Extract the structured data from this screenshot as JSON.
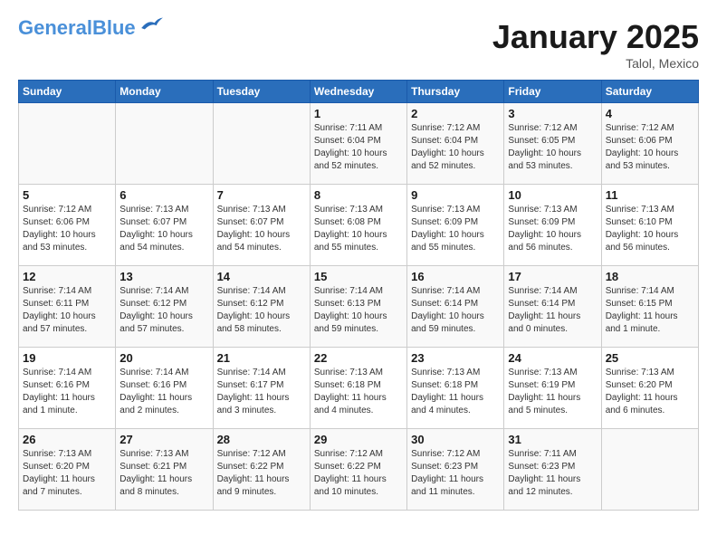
{
  "header": {
    "logo_general": "General",
    "logo_blue": "Blue",
    "title": "January 2025",
    "subtitle": "Talol, Mexico"
  },
  "days_of_week": [
    "Sunday",
    "Monday",
    "Tuesday",
    "Wednesday",
    "Thursday",
    "Friday",
    "Saturday"
  ],
  "weeks": [
    [
      {
        "num": "",
        "info": ""
      },
      {
        "num": "",
        "info": ""
      },
      {
        "num": "",
        "info": ""
      },
      {
        "num": "1",
        "info": "Sunrise: 7:11 AM\nSunset: 6:04 PM\nDaylight: 10 hours\nand 52 minutes."
      },
      {
        "num": "2",
        "info": "Sunrise: 7:12 AM\nSunset: 6:04 PM\nDaylight: 10 hours\nand 52 minutes."
      },
      {
        "num": "3",
        "info": "Sunrise: 7:12 AM\nSunset: 6:05 PM\nDaylight: 10 hours\nand 53 minutes."
      },
      {
        "num": "4",
        "info": "Sunrise: 7:12 AM\nSunset: 6:06 PM\nDaylight: 10 hours\nand 53 minutes."
      }
    ],
    [
      {
        "num": "5",
        "info": "Sunrise: 7:12 AM\nSunset: 6:06 PM\nDaylight: 10 hours\nand 53 minutes."
      },
      {
        "num": "6",
        "info": "Sunrise: 7:13 AM\nSunset: 6:07 PM\nDaylight: 10 hours\nand 54 minutes."
      },
      {
        "num": "7",
        "info": "Sunrise: 7:13 AM\nSunset: 6:07 PM\nDaylight: 10 hours\nand 54 minutes."
      },
      {
        "num": "8",
        "info": "Sunrise: 7:13 AM\nSunset: 6:08 PM\nDaylight: 10 hours\nand 55 minutes."
      },
      {
        "num": "9",
        "info": "Sunrise: 7:13 AM\nSunset: 6:09 PM\nDaylight: 10 hours\nand 55 minutes."
      },
      {
        "num": "10",
        "info": "Sunrise: 7:13 AM\nSunset: 6:09 PM\nDaylight: 10 hours\nand 56 minutes."
      },
      {
        "num": "11",
        "info": "Sunrise: 7:13 AM\nSunset: 6:10 PM\nDaylight: 10 hours\nand 56 minutes."
      }
    ],
    [
      {
        "num": "12",
        "info": "Sunrise: 7:14 AM\nSunset: 6:11 PM\nDaylight: 10 hours\nand 57 minutes."
      },
      {
        "num": "13",
        "info": "Sunrise: 7:14 AM\nSunset: 6:12 PM\nDaylight: 10 hours\nand 57 minutes."
      },
      {
        "num": "14",
        "info": "Sunrise: 7:14 AM\nSunset: 6:12 PM\nDaylight: 10 hours\nand 58 minutes."
      },
      {
        "num": "15",
        "info": "Sunrise: 7:14 AM\nSunset: 6:13 PM\nDaylight: 10 hours\nand 59 minutes."
      },
      {
        "num": "16",
        "info": "Sunrise: 7:14 AM\nSunset: 6:14 PM\nDaylight: 10 hours\nand 59 minutes."
      },
      {
        "num": "17",
        "info": "Sunrise: 7:14 AM\nSunset: 6:14 PM\nDaylight: 11 hours\nand 0 minutes."
      },
      {
        "num": "18",
        "info": "Sunrise: 7:14 AM\nSunset: 6:15 PM\nDaylight: 11 hours\nand 1 minute."
      }
    ],
    [
      {
        "num": "19",
        "info": "Sunrise: 7:14 AM\nSunset: 6:16 PM\nDaylight: 11 hours\nand 1 minute."
      },
      {
        "num": "20",
        "info": "Sunrise: 7:14 AM\nSunset: 6:16 PM\nDaylight: 11 hours\nand 2 minutes."
      },
      {
        "num": "21",
        "info": "Sunrise: 7:14 AM\nSunset: 6:17 PM\nDaylight: 11 hours\nand 3 minutes."
      },
      {
        "num": "22",
        "info": "Sunrise: 7:13 AM\nSunset: 6:18 PM\nDaylight: 11 hours\nand 4 minutes."
      },
      {
        "num": "23",
        "info": "Sunrise: 7:13 AM\nSunset: 6:18 PM\nDaylight: 11 hours\nand 4 minutes."
      },
      {
        "num": "24",
        "info": "Sunrise: 7:13 AM\nSunset: 6:19 PM\nDaylight: 11 hours\nand 5 minutes."
      },
      {
        "num": "25",
        "info": "Sunrise: 7:13 AM\nSunset: 6:20 PM\nDaylight: 11 hours\nand 6 minutes."
      }
    ],
    [
      {
        "num": "26",
        "info": "Sunrise: 7:13 AM\nSunset: 6:20 PM\nDaylight: 11 hours\nand 7 minutes."
      },
      {
        "num": "27",
        "info": "Sunrise: 7:13 AM\nSunset: 6:21 PM\nDaylight: 11 hours\nand 8 minutes."
      },
      {
        "num": "28",
        "info": "Sunrise: 7:12 AM\nSunset: 6:22 PM\nDaylight: 11 hours\nand 9 minutes."
      },
      {
        "num": "29",
        "info": "Sunrise: 7:12 AM\nSunset: 6:22 PM\nDaylight: 11 hours\nand 10 minutes."
      },
      {
        "num": "30",
        "info": "Sunrise: 7:12 AM\nSunset: 6:23 PM\nDaylight: 11 hours\nand 11 minutes."
      },
      {
        "num": "31",
        "info": "Sunrise: 7:11 AM\nSunset: 6:23 PM\nDaylight: 11 hours\nand 12 minutes."
      },
      {
        "num": "",
        "info": ""
      }
    ]
  ]
}
